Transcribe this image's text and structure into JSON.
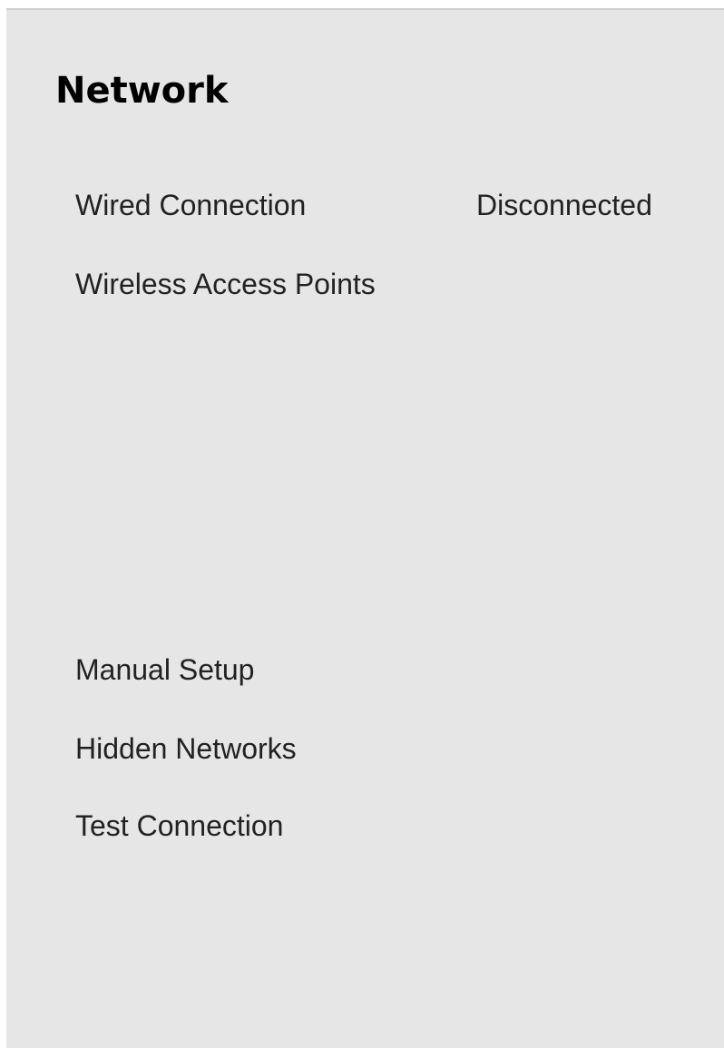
{
  "page": {
    "title": "Network"
  },
  "menu": {
    "wired_connection": {
      "label": "Wired Connection",
      "value": "Disconnected"
    },
    "wireless_access_points": {
      "label": "Wireless Access Points"
    },
    "manual_setup": {
      "label": "Manual Setup"
    },
    "hidden_networks": {
      "label": "Hidden Networks"
    },
    "test_connection": {
      "label": "Test Connection"
    }
  },
  "colors": {
    "panel_background": "#e6e6e6",
    "text": "#222222",
    "title": "#000000"
  }
}
